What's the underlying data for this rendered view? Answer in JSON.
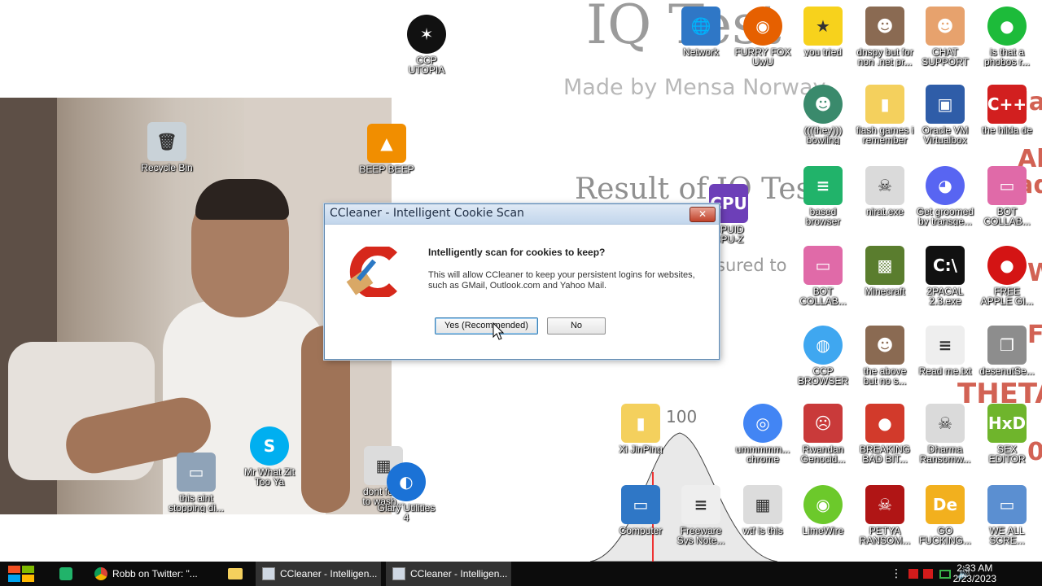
{
  "wallpaper": {
    "title": "IQ Test",
    "subtitle": "Made by Mensa Norway",
    "result": "Result of IQ Test",
    "measured": "sured to",
    "red_fragments": [
      "ida",
      "Alt",
      "Jade",
      "W",
      "F",
      "THETA",
      "0"
    ],
    "curve_label": "100"
  },
  "desktop_icons": [
    {
      "label": "CCP\nUTOPIA",
      "icon": "ccp-utopia-icon",
      "color": "#111111"
    },
    {
      "label": "Recycle Bin",
      "icon": "recycle-bin-icon",
      "color": "#c9d2d8"
    },
    {
      "label": "BEEP BEEP",
      "icon": "vlc-icon",
      "color": "#f18e00"
    },
    {
      "label": "Network",
      "icon": "network-icon",
      "color": "#2f77c6"
    },
    {
      "label": "FURRY FOX\nUwU",
      "icon": "firefox-icon",
      "color": "#e66000"
    },
    {
      "label": "you tried",
      "icon": "star-icon",
      "color": "#f7d21c"
    },
    {
      "label": "dnspy but for\nnon .net pr...",
      "icon": "portrait-icon",
      "color": "#8a6a52"
    },
    {
      "label": "CHAT\nSUPPORT",
      "icon": "support-agent-icon",
      "color": "#e7a26d"
    },
    {
      "label": "is that a\nphobos r...",
      "icon": "chat-bubble-icon",
      "color": "#1dbb3a"
    },
    {
      "label": "(((they)))\nbowling",
      "icon": "bowling-icon",
      "color": "#3a8a6c"
    },
    {
      "label": "flash games i\nremember",
      "icon": "folder-icon",
      "color": "#f4d05d"
    },
    {
      "label": "Oracle VM\nVirtualbox",
      "icon": "virtualbox-icon",
      "color": "#2f5da8"
    },
    {
      "label": "the hilda de",
      "icon": "devcpp-icon",
      "color": "#d21f1f"
    },
    {
      "label": "based\nbrowser",
      "icon": "document-green-icon",
      "color": "#21b36a"
    },
    {
      "label": "nirat.exe",
      "icon": "skull-icon",
      "color": "#dadada"
    },
    {
      "label": "Get groomed\nby transge...",
      "icon": "discord-icon",
      "color": "#5865f2"
    },
    {
      "label": "BOT\nCOLLAB...",
      "icon": "monitor-pink-icon",
      "color": "#e06aa8"
    },
    {
      "label": "CPUID\nCPU-Z",
      "icon": "cpu-z-icon",
      "color": "#6d3fb8"
    },
    {
      "label": "BOT\nCOLLAB...",
      "icon": "monitor-pink-icon",
      "color": "#e06aa8"
    },
    {
      "label": "Minecraft",
      "icon": "minecraft-icon",
      "color": "#5a7d2e"
    },
    {
      "label": "2PACAL\n2.3.exe",
      "icon": "terminal-icon",
      "color": "#111111"
    },
    {
      "label": "FREE\nAPPLE GI...",
      "icon": "apple-icon",
      "color": "#d41414"
    },
    {
      "label": "CCP\nBROWSER",
      "icon": "browser-swirl-icon",
      "color": "#3fa7f0"
    },
    {
      "label": "the above\nbut no s...",
      "icon": "portrait-icon",
      "color": "#8a6a52"
    },
    {
      "label": "Read me.txt",
      "icon": "text-file-icon",
      "color": "#eeeeee"
    },
    {
      "label": "desenutSe...",
      "icon": "stacked-windows-icon",
      "color": "#8d8d8d"
    },
    {
      "label": "Xi JinPing",
      "icon": "folder-icon",
      "color": "#f4d05d"
    },
    {
      "label": "ummmmm...\nchrome",
      "icon": "chrome-icon",
      "color": "#4285f4"
    },
    {
      "label": "Rwandan\nGenocid...",
      "icon": "meme-face-icon",
      "color": "#c93a3a"
    },
    {
      "label": "BREAKING\nBAD BIT...",
      "icon": "angry-bird-icon",
      "color": "#d23a2b"
    },
    {
      "label": "Dharma\nRansomw...",
      "icon": "skull-icon",
      "color": "#dadada"
    },
    {
      "label": "SEX\nEDITOR",
      "icon": "hxd-icon",
      "color": "#6fb52c"
    },
    {
      "label": "this aint\nstopping di...",
      "icon": "computer-icon",
      "color": "#8fa3b8"
    },
    {
      "label": "Mr What Zit\nToo Ya",
      "icon": "skype-icon",
      "color": "#00aff0"
    },
    {
      "label": "dont for...\nto wash...",
      "icon": "window-app-icon",
      "color": "#dcdcdc"
    },
    {
      "label": "Glary Utilities\n4",
      "icon": "glary-icon",
      "color": "#1b72d6"
    },
    {
      "label": "Computer",
      "icon": "computer-icon",
      "color": "#2f77c6"
    },
    {
      "label": "Freeware\nSys Note...",
      "icon": "text-file-icon",
      "color": "#eeeeee"
    },
    {
      "label": "wtf is this",
      "icon": "window-app-icon",
      "color": "#dcdcdc"
    },
    {
      "label": "LimeWire",
      "icon": "limewire-icon",
      "color": "#6cc92b"
    },
    {
      "label": "PETYA\nRANSOM...",
      "icon": "skull-red-icon",
      "color": "#b01515"
    },
    {
      "label": "GO\nFUCKING...",
      "icon": "after-effects-icon",
      "color": "#f2b01e"
    },
    {
      "label": "WE ALL\nSCRE...",
      "icon": "computer-icon",
      "color": "#5b8fd1"
    }
  ],
  "dialog": {
    "title": "CCleaner - Intelligent Cookie Scan",
    "close_label": "✕",
    "heading": "Intelligently scan for cookies to keep?",
    "body": "This will allow CCleaner to keep your persistent logins for websites, such as GMail, Outlook.com and Yahoo Mail.",
    "yes_label": "Yes (Recommended)",
    "no_label": "No"
  },
  "taskbar": {
    "buttons": [
      {
        "label": "Robb on Twitter: \"...",
        "icon": "chrome-icon"
      },
      {
        "label": "CCleaner - Intelligen...",
        "icon": "ccleaner-icon"
      },
      {
        "label": "CCleaner - Intelligen...",
        "icon": "ccleaner-icon"
      }
    ],
    "pinned": [
      "start-icon",
      "green-doc-icon",
      "folder-icon"
    ],
    "time": "2:33 AM",
    "date": "2/23/2023"
  }
}
